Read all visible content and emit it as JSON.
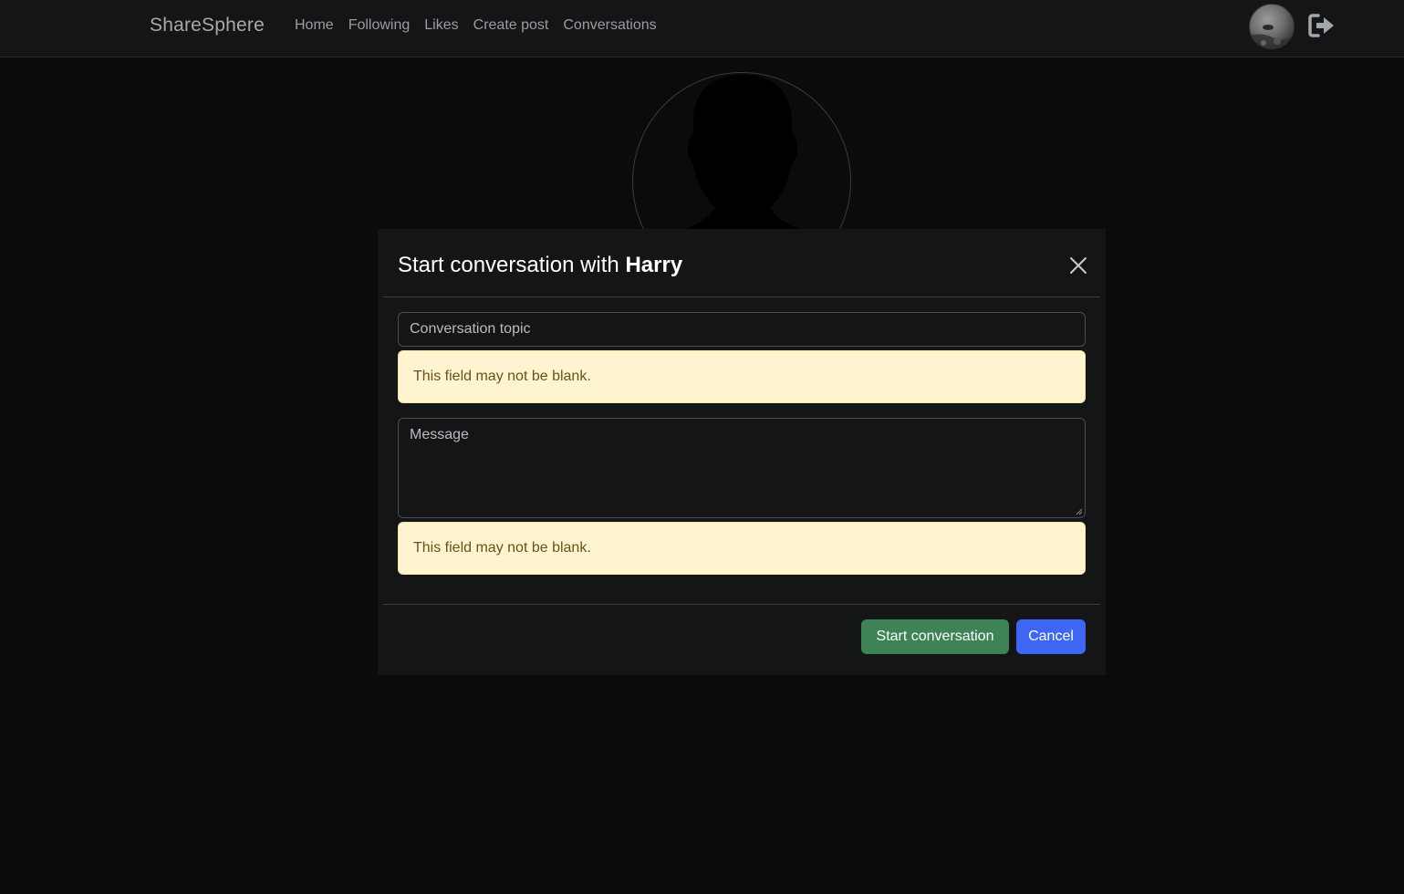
{
  "navbar": {
    "brand": "ShareSphere",
    "links": [
      "Home",
      "Following",
      "Likes",
      "Create post",
      "Conversations"
    ]
  },
  "modal": {
    "title_prefix": "Start conversation with",
    "title_name": "Harry",
    "topic_placeholder": "Conversation topic",
    "topic_error": "This field may not be blank.",
    "message_placeholder": "Message",
    "message_error": "This field may not be blank.",
    "start_button": "Start conversation",
    "cancel_button": "Cancel"
  },
  "colors": {
    "background": "#0a0b0d",
    "panel": "#141517",
    "success": "#3e8356",
    "primary": "#3d66f5",
    "warning_bg": "#fff4d0",
    "warning_text": "#65531a"
  },
  "icons": {
    "logout": "logout-icon",
    "close": "close-icon",
    "avatar": "default-avatar"
  }
}
